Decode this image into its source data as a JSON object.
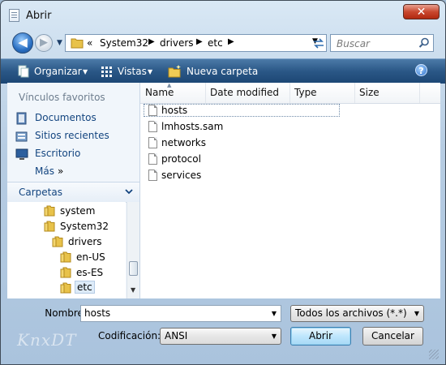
{
  "window": {
    "title": "Abrir",
    "close_label": "✕"
  },
  "nav": {
    "breadcrumb_overflow": "«",
    "breadcrumbs": [
      "System32",
      "drivers",
      "etc"
    ],
    "search_placeholder": "Buscar"
  },
  "toolbar": {
    "organize": "Organizar",
    "views": "Vistas",
    "new_folder": "Nueva carpeta",
    "help": "?"
  },
  "sidebar": {
    "favorites_header": "Vínculos favoritos",
    "favorites": [
      "Documentos",
      "Sitios recientes",
      "Escritorio"
    ],
    "more": "Más",
    "more_chevron": "»",
    "folders_header": "Carpetas",
    "tree": [
      {
        "label": "system"
      },
      {
        "label": "System32"
      },
      {
        "label": "drivers"
      },
      {
        "label": "en-US"
      },
      {
        "label": "es-ES"
      },
      {
        "label": "etc",
        "selected": true
      }
    ]
  },
  "file_list": {
    "columns": [
      "Name",
      "Date modified",
      "Type",
      "Size"
    ],
    "files": [
      "hosts",
      "lmhosts.sam",
      "networks",
      "protocol",
      "services"
    ],
    "focused_index": 0
  },
  "footer": {
    "filename_label": "Nombre:",
    "filename_value": "hosts",
    "filetype_value": "Todos los archivos  (*.*)",
    "encoding_label": "Codificación:",
    "encoding_value": "ANSI",
    "open_button": "Abrir",
    "cancel_button": "Cancelar"
  },
  "watermark": "KnxDT",
  "colors": {
    "accent": "#2a5786",
    "link": "#12447f",
    "close": "#c9482f"
  }
}
